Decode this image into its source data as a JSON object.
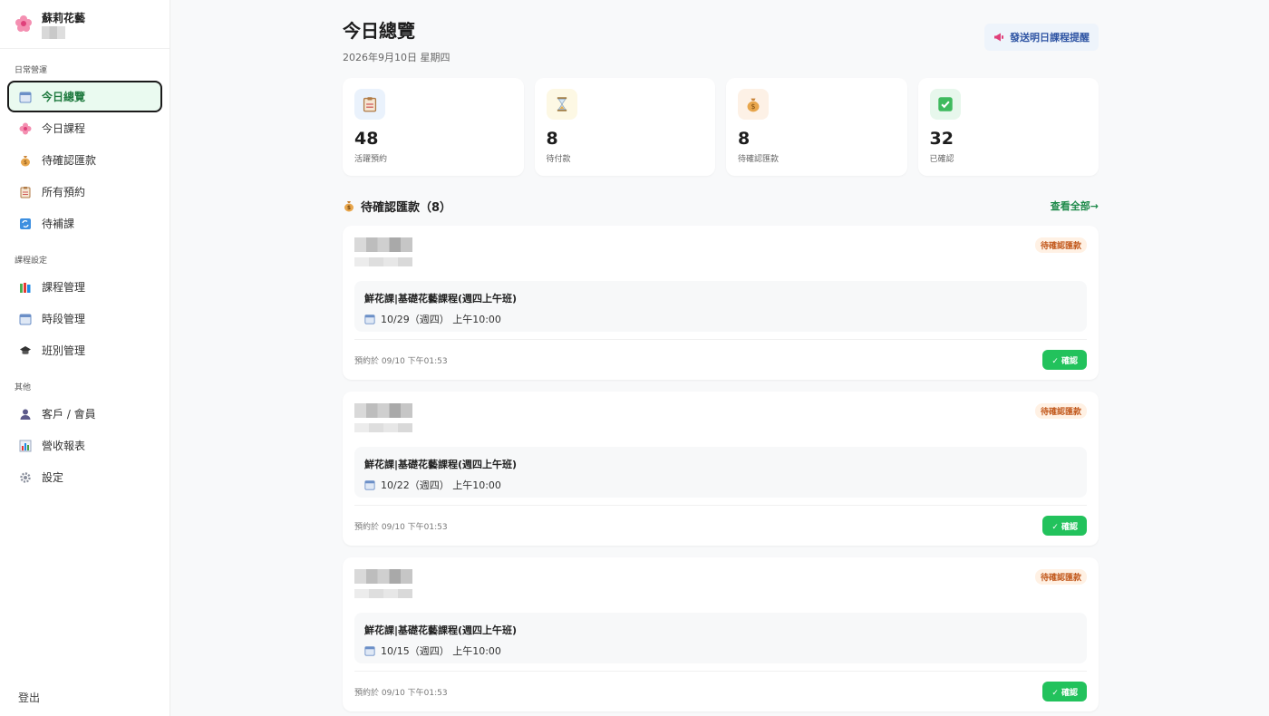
{
  "brand": {
    "name": "蘇莉花藝"
  },
  "sidebar": {
    "sections": [
      {
        "title": "日常營運",
        "items": [
          {
            "label": "今日總覽",
            "icon": "calendar-icon"
          },
          {
            "label": "今日課程",
            "icon": "flower-icon"
          },
          {
            "label": "待確認匯款",
            "icon": "money-bag-icon"
          },
          {
            "label": "所有預約",
            "icon": "clipboard-icon"
          },
          {
            "label": "待補課",
            "icon": "repeat-icon"
          }
        ]
      },
      {
        "title": "課程設定",
        "items": [
          {
            "label": "課程管理",
            "icon": "books-icon"
          },
          {
            "label": "時段管理",
            "icon": "calendar-icon"
          },
          {
            "label": "班別管理",
            "icon": "graduation-cap-icon"
          }
        ]
      },
      {
        "title": "其他",
        "items": [
          {
            "label": "客戶 / 會員",
            "icon": "user-icon"
          },
          {
            "label": "營收報表",
            "icon": "bar-chart-icon"
          },
          {
            "label": "設定",
            "icon": "gear-icon"
          }
        ]
      }
    ],
    "logout": "登出"
  },
  "header": {
    "title": "今日總覽",
    "date": "2026年9月10日 星期四",
    "remind_button": "發送明日課程提醒"
  },
  "stats": [
    {
      "value": "48",
      "label": "活躍預約",
      "icon": "clipboard-icon",
      "bg": "#eaf2fc"
    },
    {
      "value": "8",
      "label": "待付款",
      "icon": "hourglass-icon",
      "bg": "#fdf8e4"
    },
    {
      "value": "8",
      "label": "待確認匯款",
      "icon": "money-bag-icon",
      "bg": "#fdf1e6"
    },
    {
      "value": "32",
      "label": "已確認",
      "icon": "check-box-icon",
      "bg": "#e7f7ec"
    }
  ],
  "pending": {
    "title": "待確認匯款（8）",
    "view_all": "查看全部→",
    "items": [
      {
        "status": "待確認匯款",
        "course": "鮮花課|基礎花藝課程(週四上午班)",
        "time": "10/29（週四） 上午10:00",
        "booked_at": "預約於 09/10 下午01:53",
        "confirm": "✓ 確認"
      },
      {
        "status": "待確認匯款",
        "course": "鮮花課|基礎花藝課程(週四上午班)",
        "time": "10/22（週四） 上午10:00",
        "booked_at": "預約於 09/10 下午01:53",
        "confirm": "✓ 確認"
      },
      {
        "status": "待確認匯款",
        "course": "鮮花課|基礎花藝課程(週四上午班)",
        "time": "10/15（週四） 上午10:00",
        "booked_at": "預約於 09/10 下午01:53",
        "confirm": "✓ 確認"
      }
    ]
  },
  "colors": {
    "accent_green": "#22c25c",
    "active_bg": "#eafaf0",
    "badge_orange": "#c2581b"
  }
}
